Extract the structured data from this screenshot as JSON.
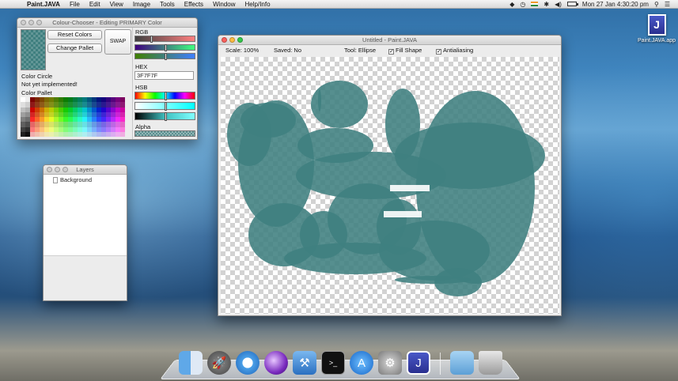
{
  "menubar": {
    "app_name": "Paint.JAVA",
    "items": [
      "File",
      "Edit",
      "View",
      "Image",
      "Tools",
      "Window",
      "Help/Info",
      "Effects"
    ],
    "clock": "Mon 27 Jan  4:30:20 pm"
  },
  "chooser": {
    "title": "Colour-Chooser - Editing PRIMARY Color",
    "reset_label": "Reset Colors",
    "pallet_label": "Change Pallet",
    "swap_label": "SWAP",
    "color_circle_label": "Color Circle",
    "not_implemented": "Not yet implemented!",
    "pallet_label_text": "Color Pallet",
    "rgb_label": "RGB",
    "hex_label": "HEX",
    "hex_value": "3F7F7F",
    "hsb_label": "HSB",
    "alpha_label": "Alpha",
    "rgb_levels": [
      0.25,
      0.5,
      0.5
    ],
    "hsb_levels": [
      0.5,
      0.5,
      0.5
    ]
  },
  "layers": {
    "title": "Layers",
    "items": [
      "Background"
    ]
  },
  "canvas": {
    "title": "Untitled - Paint.JAVA",
    "scale": "Scale: 100%",
    "saved": "Saved: No",
    "tool": "Tool: Ellipse",
    "fill_shape": "Fill Shape",
    "antialiasing": "Antialiasing",
    "fill_color": "#3f7f7f"
  },
  "desktop_icon": {
    "label": "Paint.JAVA.app"
  },
  "dock": {
    "icons": [
      "finder-icon",
      "launchpad-icon",
      "safari-icon",
      "itunes-icon",
      "xcode-icon",
      "terminal-icon",
      "app-store-icon",
      "system-preferences-icon",
      "java-app-icon",
      "folder-icon",
      "trash-icon"
    ]
  }
}
